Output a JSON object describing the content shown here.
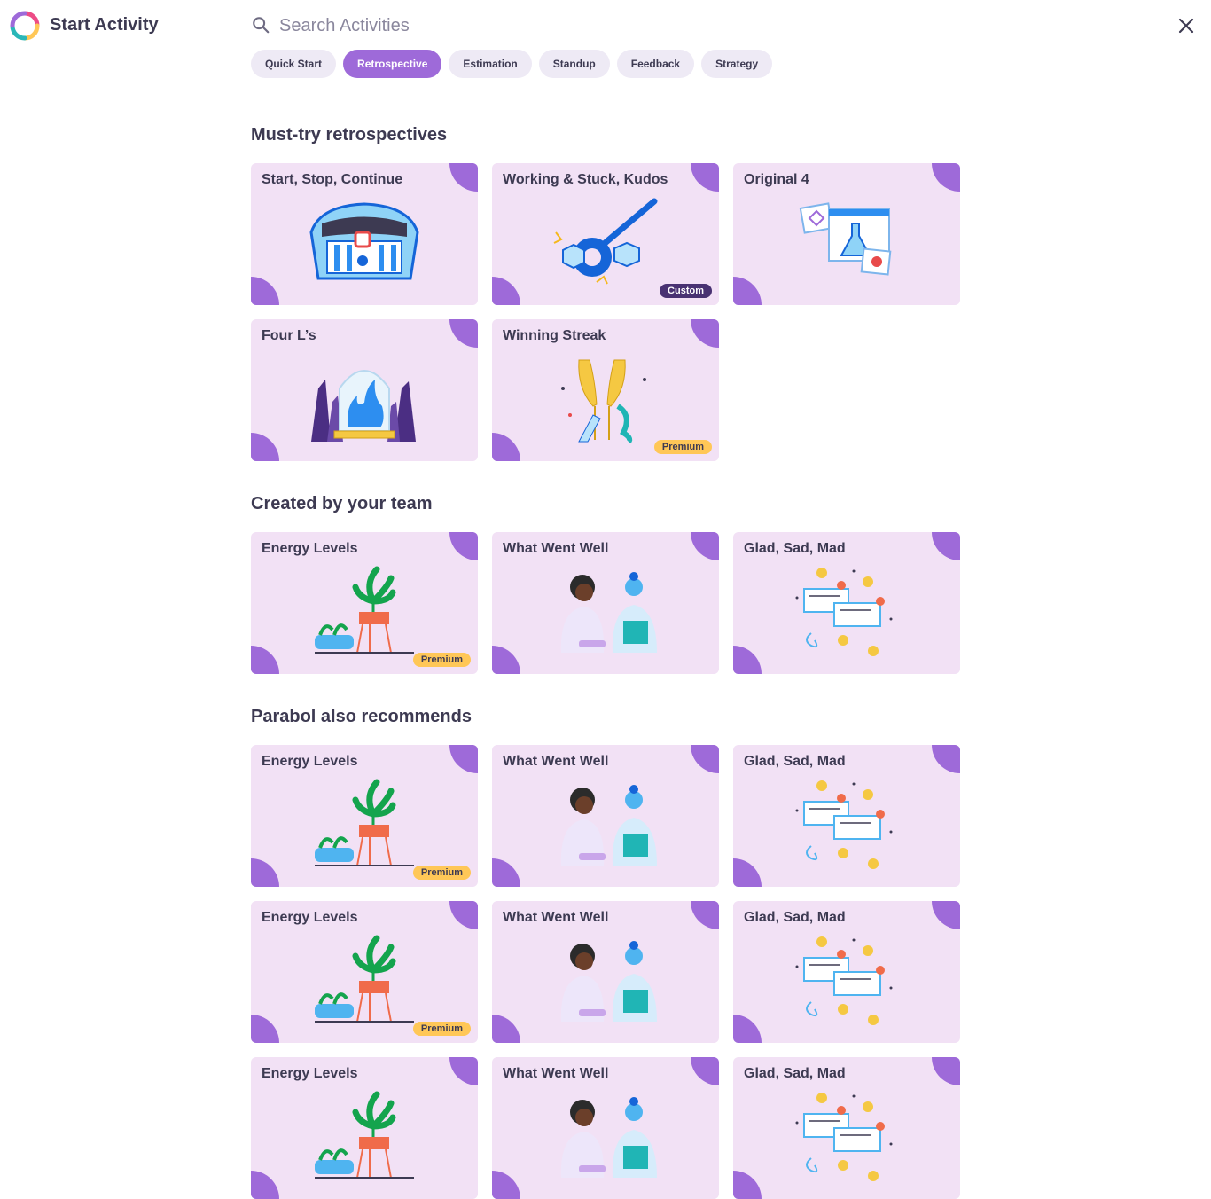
{
  "app": {
    "title": "Start Activity"
  },
  "search": {
    "placeholder": "Search Activities"
  },
  "tabs": [
    {
      "label": "Quick Start",
      "active": false
    },
    {
      "label": "Retrospective",
      "active": true
    },
    {
      "label": "Estimation",
      "active": false
    },
    {
      "label": "Standup",
      "active": false
    },
    {
      "label": "Feedback",
      "active": false
    },
    {
      "label": "Strategy",
      "active": false
    }
  ],
  "sections": [
    {
      "title": "Must-try retrospectives",
      "cards": [
        {
          "title": "Start, Stop, Continue",
          "illustration": "control-panel-illustration",
          "badge": ""
        },
        {
          "title": "Working & Stuck, Kudos",
          "illustration": "wrench-bolts-illustration",
          "badge": "Custom"
        },
        {
          "title": "Original 4",
          "illustration": "lab-flask-illustration",
          "badge": ""
        },
        {
          "title": "Four L’s",
          "illustration": "crystal-flame-illustration",
          "badge": ""
        },
        {
          "title": "Winning Streak",
          "illustration": "champagne-toast-illustration",
          "badge": "Premium"
        }
      ]
    },
    {
      "title": "Created by your team",
      "cards": [
        {
          "title": "Energy Levels",
          "illustration": "plant-illustration",
          "badge": "Premium"
        },
        {
          "title": "What Went Well",
          "illustration": "two-people-illustration",
          "badge": ""
        },
        {
          "title": "Glad, Sad, Mad",
          "illustration": "emoji-notes-illustration",
          "badge": ""
        }
      ]
    },
    {
      "title": "Parabol also recommends",
      "cards": [
        {
          "title": "Energy Levels",
          "illustration": "plant-illustration",
          "badge": "Premium"
        },
        {
          "title": "What Went Well",
          "illustration": "two-people-illustration",
          "badge": ""
        },
        {
          "title": "Glad, Sad, Mad",
          "illustration": "emoji-notes-illustration",
          "badge": ""
        },
        {
          "title": "Energy Levels",
          "illustration": "plant-illustration",
          "badge": "Premium"
        },
        {
          "title": "What Went Well",
          "illustration": "two-people-illustration",
          "badge": ""
        },
        {
          "title": "Glad, Sad, Mad",
          "illustration": "emoji-notes-illustration",
          "badge": ""
        },
        {
          "title": "Energy Levels",
          "illustration": "plant-illustration",
          "badge": ""
        },
        {
          "title": "What Went Well",
          "illustration": "two-people-illustration",
          "badge": ""
        },
        {
          "title": "Glad, Sad, Mad",
          "illustration": "emoji-notes-illustration",
          "badge": ""
        }
      ]
    }
  ],
  "colors": {
    "accent": "#9e6ad9",
    "card_bg": "#f2e1f5",
    "premium": "#ffc757",
    "custom": "#493272"
  }
}
